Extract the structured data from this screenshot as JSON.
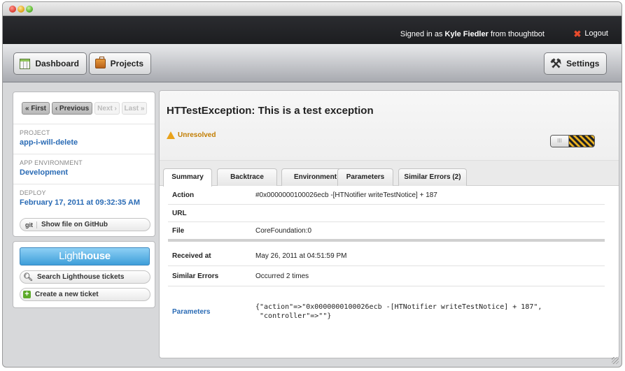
{
  "signbar": {
    "signed_prefix": "Signed in as",
    "user": "Kyle Fiedler",
    "signed_suffix": "from thoughtbot",
    "logout": "Logout"
  },
  "nav": {
    "dashboard": "Dashboard",
    "projects": "Projects",
    "settings": "Settings"
  },
  "pager": {
    "first": "« First",
    "previous": "‹ Previous",
    "next": "Next ›",
    "last": "Last »"
  },
  "sidebar": {
    "project_label": "PROJECT",
    "project_value": "app-i-will-delete",
    "env_label": "APP ENVIRONMENT",
    "env_value": "Development",
    "deploy_label": "DEPLOY",
    "deploy_value": "February 17, 2011 at 09:32:35 AM",
    "github_icon_text": "git",
    "github_button": "Show file on GitHub",
    "lighthouse_light": "Light",
    "lighthouse_house": "house",
    "search_tickets": "Search Lighthouse tickets",
    "new_ticket": "Create a new ticket"
  },
  "main": {
    "title": "HTTestException: This is a test exception",
    "status": "Unresolved",
    "toggle_label": "III",
    "tabs": [
      {
        "label": "Summary"
      },
      {
        "label": "Backtrace"
      },
      {
        "label": "Environment"
      },
      {
        "label": "Parameters"
      },
      {
        "label": "Similar Errors (2)"
      }
    ],
    "rows": {
      "action_key": "Action",
      "action_value": "#0x0000000100026ecb -[HTNotifier writeTestNotice] + 187",
      "url_key": "URL",
      "url_value": "",
      "file_key": "File",
      "file_value": "CoreFoundation:0",
      "received_key": "Received at",
      "received_value": "May 26, 2011 at 04:51:59 PM",
      "similar_key": "Similar Errors",
      "similar_value": "Occurred 2 times",
      "params_key": "Parameters",
      "params_value": "{\"action\"=>\"0x0000000100026ecb -[HTNotifier writeTestNotice] + 187\",\n \"controller\"=>\"\"}"
    }
  },
  "colors": {
    "link": "#2a6bb5",
    "status": "#c27d00",
    "accent_blue": "#3d9ed9"
  }
}
